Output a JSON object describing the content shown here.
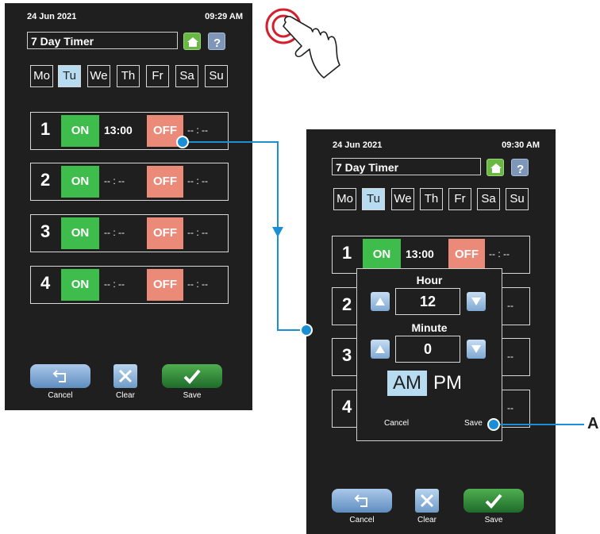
{
  "screen1": {
    "date": "24 Jun 2021",
    "time": "09:29 AM",
    "title": "7 Day Timer",
    "days": [
      "Mo",
      "Tu",
      "We",
      "Th",
      "Fr",
      "Sa",
      "Su"
    ],
    "selected_day": "Tu",
    "rows": [
      {
        "num": "1",
        "on_label": "ON",
        "on_time": "13:00",
        "off_label": "OFF",
        "off_time": "-- : --"
      },
      {
        "num": "2",
        "on_label": "ON",
        "on_time": "-- : --",
        "off_label": "OFF",
        "off_time": "-- : --"
      },
      {
        "num": "3",
        "on_label": "ON",
        "on_time": "-- : --",
        "off_label": "OFF",
        "off_time": "-- : --"
      },
      {
        "num": "4",
        "on_label": "ON",
        "on_time": "-- : --",
        "off_label": "OFF",
        "off_time": "-- : --"
      }
    ],
    "buttons": {
      "cancel": "Cancel",
      "clear": "Clear",
      "save": "Save"
    }
  },
  "screen2": {
    "date": "24 Jun 2021",
    "time": "09:30 AM",
    "title": "7 Day Timer",
    "days": [
      "Mo",
      "Tu",
      "We",
      "Th",
      "Fr",
      "Sa",
      "Su"
    ],
    "selected_day": "Tu",
    "rows": [
      {
        "num": "1",
        "on_label": "ON",
        "on_time": "13:00",
        "off_label": "OFF",
        "off_time": "-- : --"
      },
      {
        "num": "2",
        "trail": "--"
      },
      {
        "num": "3",
        "trail": "--"
      },
      {
        "num": "4",
        "trail": "--"
      }
    ],
    "popup": {
      "hour_label": "Hour",
      "hour_value": "12",
      "minute_label": "Minute",
      "minute_value": "0",
      "am": "AM",
      "pm": "PM",
      "cancel": "Cancel",
      "save": "Save"
    },
    "buttons": {
      "cancel": "Cancel",
      "clear": "Clear",
      "save": "Save"
    }
  },
  "callout": "A",
  "colors": {
    "on": "#3ebd4c",
    "off": "#ec8a7a",
    "selected": "#b7dcf2",
    "connector": "#1a8fd6"
  }
}
